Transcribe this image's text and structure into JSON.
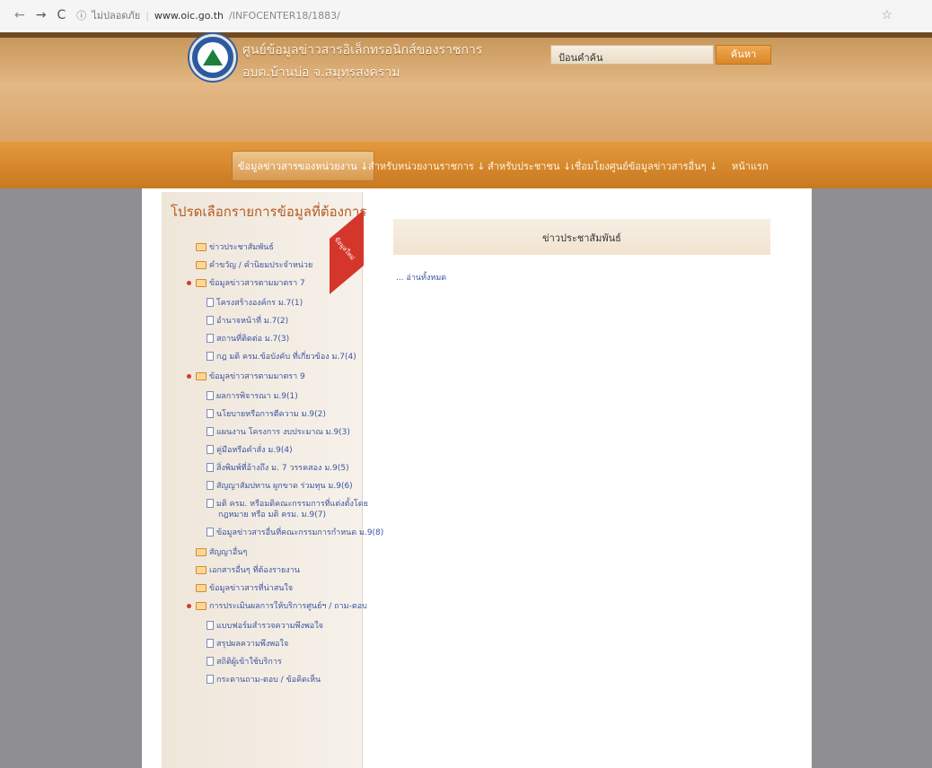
{
  "browser": {
    "back": "←",
    "forward": "→",
    "reload": "C",
    "info": "ⓘ",
    "secure_label": "ไม่ปลอดภัย",
    "url_host": "www.oic.go.th",
    "url_path": "/INFOCENTER18/1883/",
    "star": "☆"
  },
  "header": {
    "title_line1": "ศูนย์ข้อมูลข่าวสารอิเล็กทรอนิกส์ของราชการ",
    "title_line2": "อบต.บ้านบ่อ จ.สมุทรสงคราม",
    "search_placeholder": "ป้อนคำค้น",
    "search_button": "ค้นหา"
  },
  "nav": {
    "items": [
      {
        "label": "ข้อมูลข่าวสารของหน่วยงาน ↓"
      },
      {
        "label": "สำหรับหน่วยงานราชการ ↓"
      },
      {
        "label": "สำหรับประชาชน ↓"
      },
      {
        "label": "เชื่อมโยงศูนย์ข้อมูลข่าวสารอื่นๆ ↓"
      },
      {
        "label": "หน้าแรก"
      }
    ]
  },
  "sidebar": {
    "title": "โปรดเลือกรายการข้อมูลที่ต้องการ",
    "ribbon": "ข้อมูลใหม่",
    "items": [
      {
        "label": "ข่าวประชาสัมพันธ์"
      },
      {
        "label": "คำขวัญ / คำนิยมประจำหน่วย"
      },
      {
        "label": "ข้อมูลข่าวสารตามมาตรา 7"
      },
      {
        "label": "โครงสร้างองค์กร ม.7(1)"
      },
      {
        "label": "อำนาจหน้าที่ ม.7(2)"
      },
      {
        "label": "สถานที่ติดต่อ ม.7(3)"
      },
      {
        "label": "กฎ มติ ครม.ข้อบังคับ ที่เกี่ยวข้อง ม.7(4)"
      },
      {
        "label": "ข้อมูลข่าวสารตามมาตรา 9"
      },
      {
        "label": "ผลการพิจารณา ม.9(1)"
      },
      {
        "label": "นโยบายหรือการตีความ ม.9(2)"
      },
      {
        "label": "แผนงาน โครงการ งบประมาณ ม.9(3)"
      },
      {
        "label": "คู่มือหรือคำสั่ง ม.9(4)"
      },
      {
        "label": "สิ่งพิมพ์ที่อ้างถึง ม. 7 วรรคสอง ม.9(5)"
      },
      {
        "label": "สัญญาสัมปทาน ผูกขาด ร่วมทุน ม.9(6)"
      },
      {
        "label": "มติ ครม. หรือมติคณะกรรมการที่แต่งตั้งโดย"
      },
      {
        "label": "กฎหมาย หรือ มติ ครม. ม.9(7)"
      },
      {
        "label": "ข้อมูลข่าวสารอื่นที่คณะกรรมการกำหนด ม.9(8)"
      },
      {
        "label": "สัญญาอื่นๆ"
      },
      {
        "label": "เอกสารอื่นๆ ที่ต้องรายงาน"
      },
      {
        "label": "ข้อมูลข่าวสารที่น่าสนใจ"
      },
      {
        "label": "การประเมินผลการให้บริการศูนย์ฯ / ถาม-ตอบ"
      },
      {
        "label": "แบบฟอร์มสำรวจความพึงพอใจ"
      },
      {
        "label": "สรุปผลความพึงพอใจ"
      },
      {
        "label": "สถิติผู้เข้าใช้บริการ"
      },
      {
        "label": "กระดานถาม-ตอบ / ข้อคิดเห็น"
      }
    ]
  },
  "content": {
    "title": "ข่าวประชาสัมพันธ์",
    "read_all": "... อ่านทั้งหมด"
  }
}
